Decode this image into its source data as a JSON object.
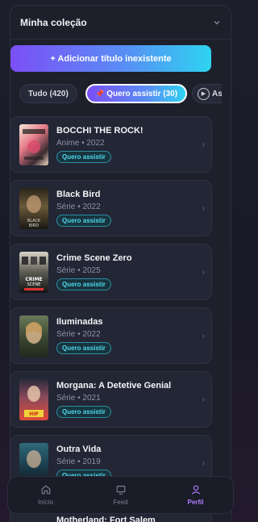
{
  "collection": {
    "title": "Minha coleção"
  },
  "add_button": {
    "label": "+ Adicionar título inexistente"
  },
  "tabs": [
    {
      "label": "Tudo (420)"
    },
    {
      "label": "Quero assistir (30)"
    },
    {
      "label": "Assist"
    }
  ],
  "items": [
    {
      "title": "BOCCHI THE ROCK!",
      "meta": "Anime • 2022",
      "badge": "Quero assistir"
    },
    {
      "title": "Black Bird",
      "meta": "Série • 2022",
      "badge": "Quero assistir"
    },
    {
      "title": "Crime Scene Zero",
      "meta": "Série • 2025",
      "badge": "Quero assistir"
    },
    {
      "title": "Iluminadas",
      "meta": "Série • 2022",
      "badge": "Quero assistir"
    },
    {
      "title": "Morgana: A Detetive Genial",
      "meta": "Série • 2021",
      "badge": "Quero assistir"
    },
    {
      "title": "Outra Vida",
      "meta": "Série • 2019",
      "badge": "Quero assistir"
    }
  ],
  "peek_item": {
    "title": "Motherland: Fort Salem"
  },
  "nav": {
    "home": "Início",
    "feed": "Feed",
    "profile": "Perfil"
  },
  "colors": {
    "accent_start": "#7b4ff5",
    "accent_end": "#2ed3f0",
    "badge_text": "#4fd8ee",
    "active_nav": "#b27bff"
  }
}
